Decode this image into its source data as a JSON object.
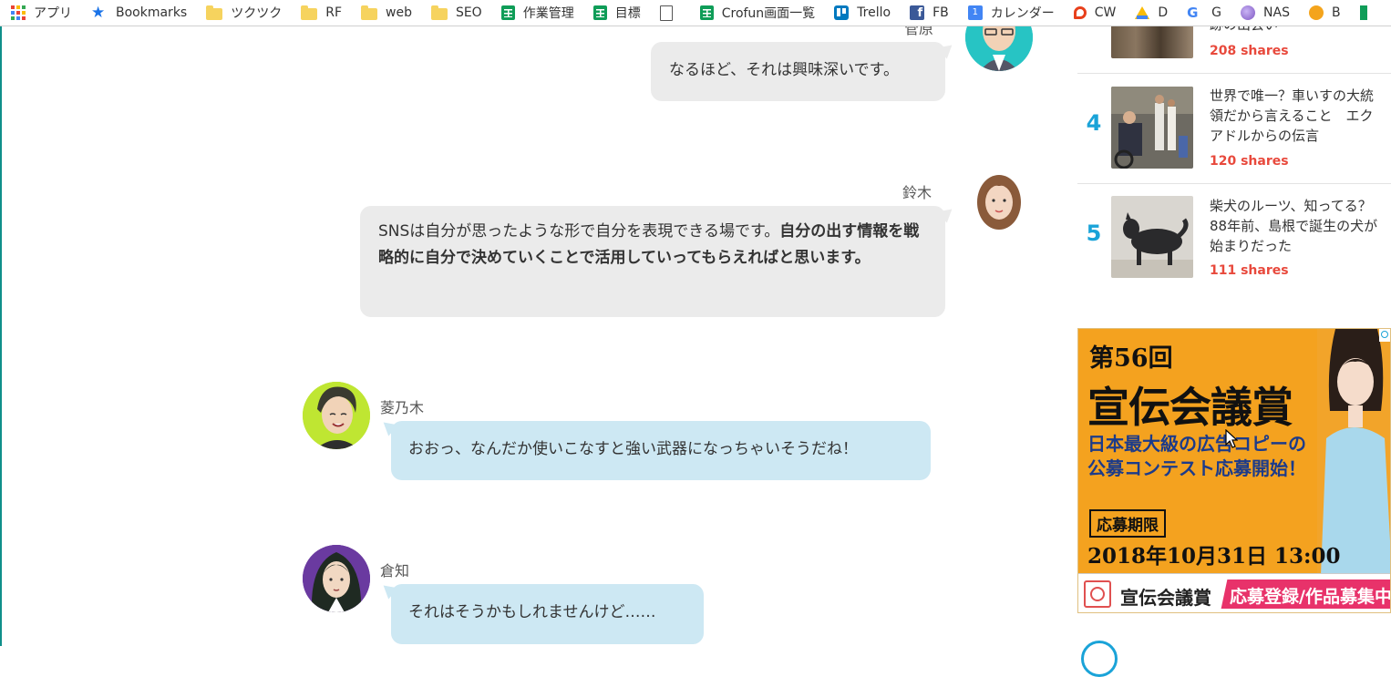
{
  "bookmarks": [
    {
      "label": "アプリ",
      "icon": "apps-icon"
    },
    {
      "label": "Bookmarks",
      "icon": "star-icon"
    },
    {
      "label": "ツクツク",
      "icon": "folder-icon"
    },
    {
      "label": "RF",
      "icon": "folder-icon"
    },
    {
      "label": "web",
      "icon": "folder-icon"
    },
    {
      "label": "SEO",
      "icon": "folder-icon"
    },
    {
      "label": "作業管理",
      "icon": "sheets-icon"
    },
    {
      "label": "目標",
      "icon": "sheets-icon"
    },
    {
      "label": "",
      "icon": "document-icon"
    },
    {
      "label": "Crofun画面一覧",
      "icon": "sheets-icon"
    },
    {
      "label": "Trello",
      "icon": "trello-icon"
    },
    {
      "label": "FB",
      "icon": "facebook-icon"
    },
    {
      "label": "カレンダー",
      "icon": "calendar-icon"
    },
    {
      "label": "CW",
      "icon": "chatwork-icon"
    },
    {
      "label": "D",
      "icon": "drive-icon"
    },
    {
      "label": "G",
      "icon": "google-icon"
    },
    {
      "label": "NAS",
      "icon": "nas-icon"
    },
    {
      "label": "B",
      "icon": "b-icon"
    },
    {
      "label": "",
      "icon": "sheets-icon"
    }
  ],
  "calendar_icon_text": "1",
  "chat": {
    "msg1": {
      "name": "菅原",
      "text": "なるほど、それは興味深いです。"
    },
    "msg2": {
      "name": "鈴木",
      "text_plain": "SNSは自分が思ったような形で自分を表現できる場です。",
      "text_bold": "自分の出す情報を戦略的に自分で決めていくことで活用していってもらえればと思います。"
    },
    "msg3": {
      "name": "菱乃木",
      "text": "おおっ、なんだか使いこなすと強い武器になっちゃいそうだね！"
    },
    "msg4": {
      "name": "倉知",
      "text": "それはそうかもしれませんけど……"
    }
  },
  "ranking": {
    "item3": {
      "title_tail": "跡の出会い",
      "shares": "208 shares"
    },
    "item4": {
      "rank": "4",
      "title": "世界で唯一？車いすの大統領だから言えること　エクアドルからの伝言",
      "shares": "120 shares"
    },
    "item5": {
      "rank": "5",
      "title": "柴犬のルーツ、知ってる？　88年前、島根で誕生の犬が始まりだった",
      "shares": "111 shares"
    }
  },
  "ad": {
    "edition": "第56回",
    "title": "宣伝会議賞",
    "sub1": "日本最大級の広告コピーの",
    "sub2": "公募コンテスト応募開始！",
    "deadline_label": "応募期限",
    "deadline": "2018年10月31日 13:00",
    "brand": "宣伝会議賞",
    "cta": "応募登録/作品募集中"
  },
  "colors": {
    "accent": "#1aa3d8",
    "shares": "#e8493c",
    "bubble_gray": "#ebebeb",
    "bubble_blue": "#cde8f3",
    "ad_bg": "#f4a21f"
  }
}
